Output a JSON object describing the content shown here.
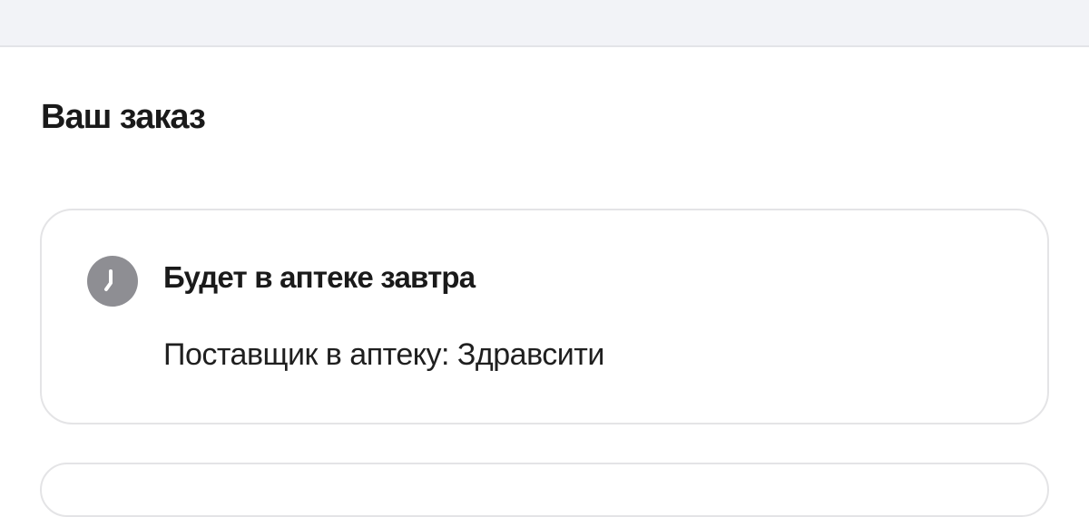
{
  "order": {
    "title": "Ваш заказ",
    "card": {
      "icon": "clock-icon",
      "icon_color": "#8e8e93",
      "status": "Будет в аптеке завтра",
      "supplier": "Поставщик в аптеку: Здравсити"
    }
  }
}
